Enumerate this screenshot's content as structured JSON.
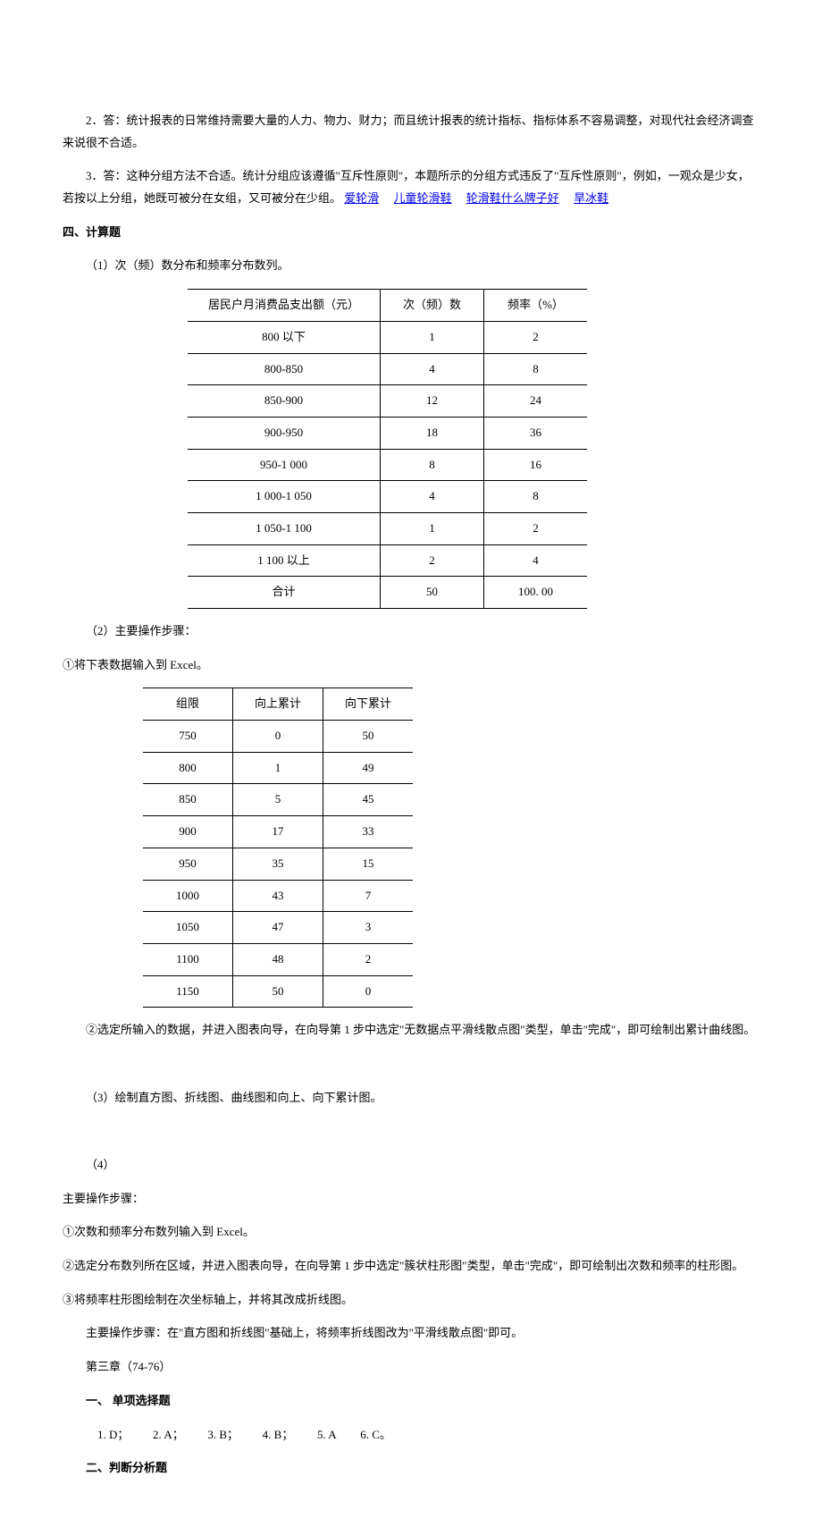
{
  "p1_prefix": "2．答：",
  "p1": "统计报表的日常维持需要大量的人力、物力、财力；而且统计报表的统计指标、指标体系不容易调整，对现代社会经济调查来说很不合适。",
  "p2_prefix": "3．答：",
  "p2a": "这种分组方法不合适。统计分组应该遵循\"互斥性原则\"，本题所示的分组方式违反了\"互斥性原则\"，例如，一观众是少女，若按以上分组，她既可被分在女组，又可被分在少组。",
  "links": [
    "爱轮滑",
    "儿童轮滑鞋",
    "轮滑鞋什么牌子好",
    "旱冰鞋"
  ],
  "h_calc": "四、计算题",
  "calc_1": "（1）次（频）数分布和频率分布数列。",
  "table1": {
    "headers": [
      "居民户月消费品支出额（元）",
      "次（频）数",
      "频率（%）"
    ],
    "rows": [
      [
        "800 以下",
        "1",
        "2"
      ],
      [
        "800-850",
        "4",
        "8"
      ],
      [
        "850-900",
        "12",
        "24"
      ],
      [
        "900-950",
        "18",
        "36"
      ],
      [
        "950-1 000",
        "8",
        "16"
      ],
      [
        "1 000-1 050",
        "4",
        "8"
      ],
      [
        "1 050-1 100",
        "1",
        "2"
      ],
      [
        "1 100 以上",
        "2",
        "4"
      ],
      [
        "合计",
        "50",
        "100. 00"
      ]
    ]
  },
  "calc_2": "（2）主要操作步骤：",
  "calc_2_1": "①将下表数据输入到 Excel。",
  "table2": {
    "headers": [
      "组限",
      "向上累计",
      "向下累计"
    ],
    "rows": [
      [
        "750",
        "0",
        "50"
      ],
      [
        "800",
        "1",
        "49"
      ],
      [
        "850",
        "5",
        "45"
      ],
      [
        "900",
        "17",
        "33"
      ],
      [
        "950",
        "35",
        "15"
      ],
      [
        "1000",
        "43",
        "7"
      ],
      [
        "1050",
        "47",
        "3"
      ],
      [
        "1100",
        "48",
        "2"
      ],
      [
        "1150",
        "50",
        "0"
      ]
    ]
  },
  "calc_2_2": "②选定所输入的数据，并进入图表向导，在向导第 1 步中选定\"无数据点平滑线散点图\"类型，单击\"完成\"，即可绘制出累计曲线图。",
  "calc_3": "（3）绘制直方图、折线图、曲线图和向上、向下累计图。",
  "calc_4": "（4）",
  "steps_h": "主要操作步骤：",
  "step_a": "①次数和频率分布数列输入到 Excel。",
  "step_b": "②选定分布数列所在区域，并进入图表向导，在向导第 1 步中选定\"簇状柱形图\"类型，单击\"完成\"，即可绘制出次数和频率的柱形图。",
  "step_c": "③将频率柱形图绘制在次坐标轴上，并将其改成折线图。",
  "step_note": "主要操作步骤：在\"直方图和折线图\"基础上，将频率折线图改为\"平滑线散点图\"即可。",
  "chapter3": "第三章（74-76）",
  "mc_heading": "一、 单项选择题",
  "mc_answers": [
    "1. D；",
    "2. A；",
    "3. B；",
    "4. B；",
    "5. A",
    "6. C。"
  ],
  "section2_heading": "二、判断分析题",
  "chart_data": [
    {
      "type": "table",
      "title": "次（频）数分布和频率分布数列",
      "columns": [
        "居民户月消费品支出额（元）",
        "次（频）数",
        "频率（%）"
      ],
      "rows": [
        [
          "800 以下",
          1,
          2
        ],
        [
          "800-850",
          4,
          8
        ],
        [
          "850-900",
          12,
          24
        ],
        [
          "900-950",
          18,
          36
        ],
        [
          "950-1 000",
          8,
          16
        ],
        [
          "1 000-1 050",
          4,
          8
        ],
        [
          "1 050-1 100",
          1,
          2
        ],
        [
          "1 100 以上",
          2,
          4
        ]
      ],
      "totals": [
        "合计",
        50,
        100.0
      ]
    },
    {
      "type": "table",
      "title": "累计分布",
      "columns": [
        "组限",
        "向上累计",
        "向下累计"
      ],
      "rows": [
        [
          750,
          0,
          50
        ],
        [
          800,
          1,
          49
        ],
        [
          850,
          5,
          45
        ],
        [
          900,
          17,
          33
        ],
        [
          950,
          35,
          15
        ],
        [
          1000,
          43,
          7
        ],
        [
          1050,
          47,
          3
        ],
        [
          1100,
          48,
          2
        ],
        [
          1150,
          50,
          0
        ]
      ]
    }
  ]
}
